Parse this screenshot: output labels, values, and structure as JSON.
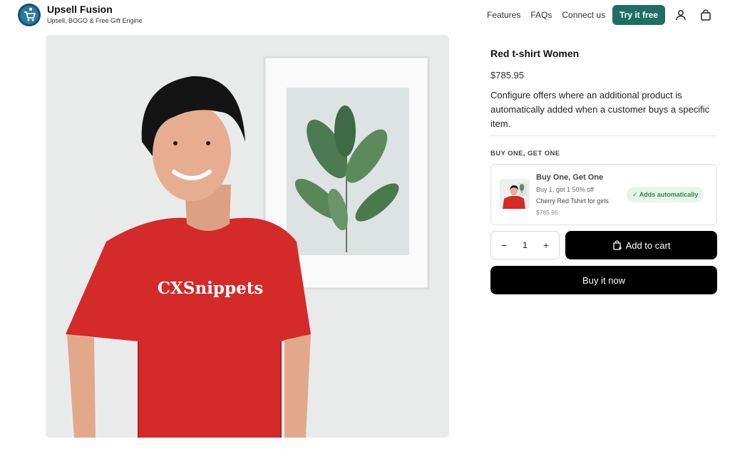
{
  "header": {
    "brand_name": "Upsell Fusion",
    "brand_tagline": "Upsell, BOGO & Free Gift Engine",
    "nav": [
      "Features",
      "FAQs",
      "Connect us"
    ],
    "cta_label": "Try it free",
    "accent_color": "#1f6e62",
    "icons": [
      "logo-icon",
      "user-icon",
      "bag-icon"
    ]
  },
  "product": {
    "image_text": "CXSnippets",
    "title": "Red t-shirt Women",
    "price": "$785.95",
    "description": "Configure offers where an additional product is automatically added when a customer buys a specific item."
  },
  "offer": {
    "section_label": "BUY ONE, GET ONE",
    "title": "Buy One, Get One",
    "subtitle": "Buy 1, get 1 50% off",
    "product_name": "Cherry Red Tshirt for girls",
    "price": "$785.95",
    "badge": "✓ Adds automatically",
    "badge_color": "#2e8b46"
  },
  "cart": {
    "minus": "−",
    "quantity": "1",
    "plus": "+",
    "add_to_cart": "Add to cart",
    "buy_now": "Buy it now"
  }
}
